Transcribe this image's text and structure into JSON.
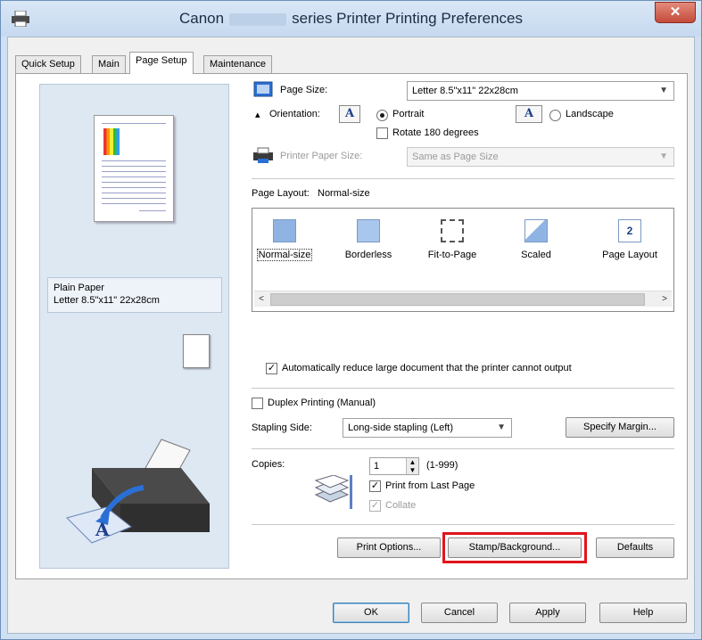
{
  "window": {
    "title_prefix": "Canon",
    "title_suffix": "series Printer Printing Preferences",
    "close_label": "✕"
  },
  "tabs": [
    "Quick Setup",
    "Main",
    "Page Setup",
    "Maintenance"
  ],
  "active_tab": "Page Setup",
  "preview": {
    "paper_type": "Plain Paper",
    "paper_size": "Letter 8.5\"x11\" 22x28cm"
  },
  "page_size": {
    "label": "Page Size:",
    "value": "Letter 8.5\"x11\" 22x28cm"
  },
  "orientation": {
    "label": "Orientation:",
    "portrait_label": "Portrait",
    "landscape_label": "Landscape",
    "selected": "Portrait",
    "rotate_label": "Rotate 180 degrees",
    "icon_glyph": "A"
  },
  "printer_paper_size": {
    "label": "Printer Paper Size:",
    "value": "Same as Page Size",
    "enabled": false
  },
  "page_layout": {
    "label": "Page Layout:",
    "current": "Normal-size",
    "items": [
      "Normal-size",
      "Borderless",
      "Fit-to-Page",
      "Scaled",
      "Page Layout"
    ],
    "page_layout_icon_digit": "2",
    "scroll_left": "<",
    "scroll_right": ">"
  },
  "auto_reduce": {
    "label": "Automatically reduce large document that the printer cannot output",
    "checked": true
  },
  "duplex": {
    "label": "Duplex Printing (Manual)",
    "checked": false
  },
  "stapling": {
    "label": "Stapling Side:",
    "value": "Long-side stapling (Left)",
    "margin_button": "Specify Margin..."
  },
  "copies": {
    "label": "Copies:",
    "value": "1",
    "range": "(1-999)",
    "last_page_label": "Print from Last Page",
    "last_page_checked": true,
    "collate_label": "Collate",
    "collate_checked": true
  },
  "tab_buttons": {
    "print_options": "Print Options...",
    "stamp_background": "Stamp/Background...",
    "defaults": "Defaults"
  },
  "dialog_buttons": {
    "ok": "OK",
    "cancel": "Cancel",
    "apply": "Apply",
    "help": "Help"
  },
  "colors": {
    "highlight": "#e0151c",
    "accent": "#3c7fb1",
    "title_bg": "#c6d9ef"
  }
}
